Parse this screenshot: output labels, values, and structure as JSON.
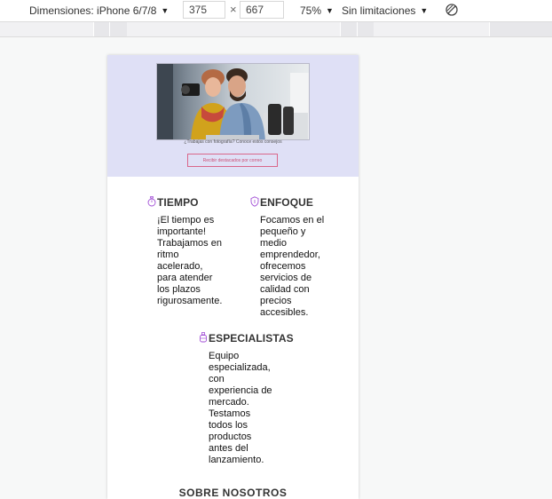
{
  "toolbar": {
    "device_label": "Dimensiones: iPhone 6/7/8",
    "width_value": "375",
    "times_symbol": "×",
    "height_value": "667",
    "zoom_label": "75%",
    "throttle_label": "Sin limitaciones",
    "rotate_icon": "rotate-icon"
  },
  "hero": {
    "caption": "¿Trabajas con fotografía? Conoce estos consejos",
    "cta_label": "Recibir destacados por correo",
    "photo_icon": "photo-image",
    "accent": "#dfe0f6",
    "cta_color": "#d9668a"
  },
  "features": [
    {
      "title": "TIEMPO",
      "icon": "stopwatch-icon",
      "text": "¡El tiempo es\nimportante!\nTrabajamos en\nritmo\nacelerado,\npara atender\nlos plazos\nrigurosamente."
    },
    {
      "title": "ENFOQUE",
      "icon": "shield-icon",
      "text": "Focamos en el\npequeño y\nmedio\nemprendedor,\nofrecemos\nservicios de\ncalidad con\nprecios\naccesibles."
    },
    {
      "title": "ESPECIALISTAS",
      "icon": "bottle-icon",
      "text": "Equipo\nespecializada,\ncon\nexperiencia de\nmercado.\nTestamos\ntodos los\nproductos\nantes del\nlanzamiento."
    }
  ],
  "about": {
    "title": "SOBRE NOSOTROS"
  },
  "colors": {
    "icon_purple": "#a24fd6"
  }
}
